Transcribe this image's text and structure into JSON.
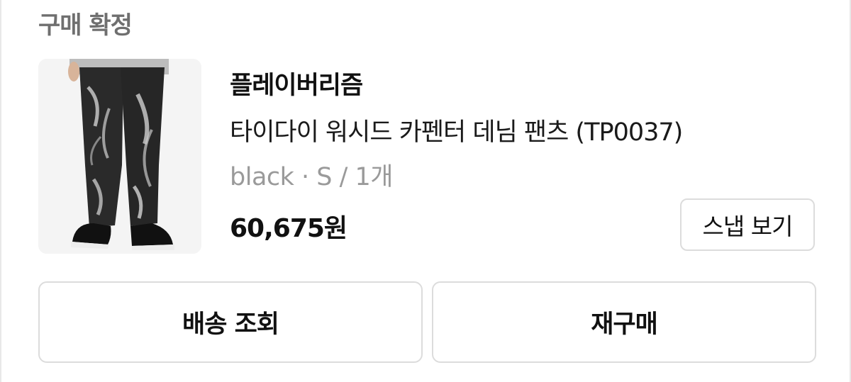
{
  "order": {
    "status": "구매 확정",
    "brand": "플레이버리즘",
    "product_name": "타이다이 워시드 카펜터 데님 팬츠 (TP0037)",
    "option": "black · S / 1개",
    "price": "60,675원"
  },
  "actions": {
    "snap_label": "스냅 보기",
    "track_label": "배송 조회",
    "rebuy_label": "재구매"
  },
  "colors": {
    "status_text": "#6f6f6f",
    "option_text": "#9a9a9a",
    "border": "#dcdcdc"
  }
}
